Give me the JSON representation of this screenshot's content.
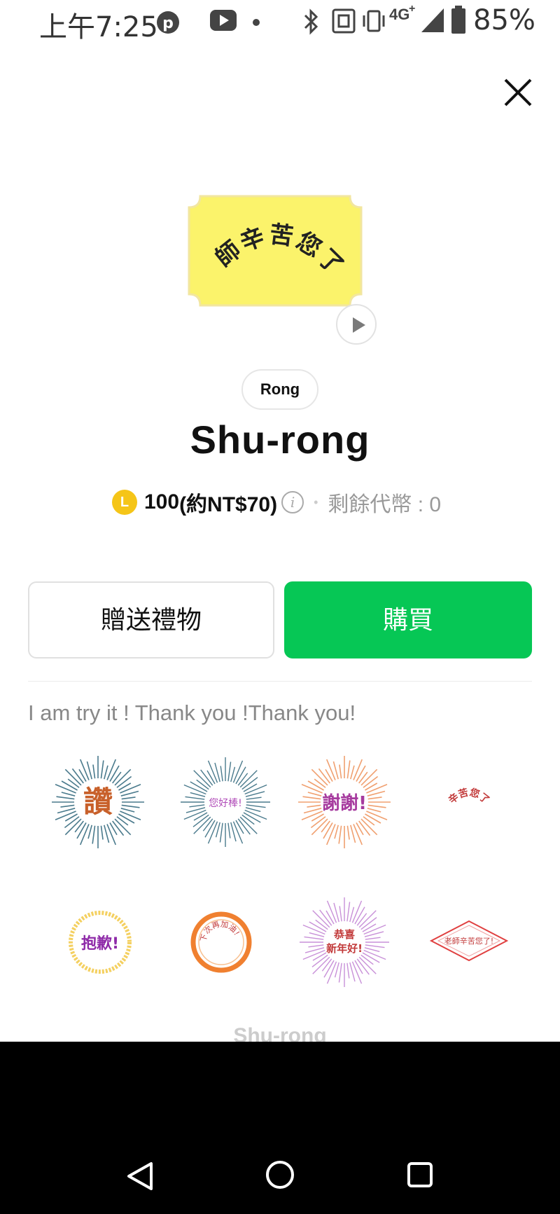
{
  "status_bar": {
    "time": "上午7:25",
    "network": "4G",
    "network_plus": "+",
    "battery": "85%"
  },
  "hero": {
    "sticker_text": "老師辛苦您了!"
  },
  "product": {
    "author": "Rong",
    "title": "Shu-rong",
    "coin_symbol": "L",
    "price": "100",
    "price_local": "(約NT$70)",
    "info_symbol": "i",
    "remaining_coins": "剩餘代幣 : 0"
  },
  "actions": {
    "gift_label": "贈送禮物",
    "buy_label": "購買",
    "buy_color": "#06c755"
  },
  "description": "I am try it ! Thank you !Thank you!",
  "stickers": [
    {
      "text": "讚",
      "color": "#c8602a"
    },
    {
      "text": "您好棒!",
      "color": "#b04bb8"
    },
    {
      "text": "謝謝!",
      "color": "#a63a9e"
    },
    {
      "text": "辛苦您了",
      "color": "#c23a3a"
    },
    {
      "text": "抱歉!",
      "color": "#8e2aa8"
    },
    {
      "text": "下次再加油!",
      "color": "#c23a3a"
    },
    {
      "text_line1": "恭喜",
      "text_line2": "新年好!",
      "color": "#c23a3a"
    },
    {
      "text": "老師辛苦您了!",
      "color": "#c23a3a"
    }
  ],
  "footer_name": "Shu-rong",
  "icons": [
    "pinterest-icon",
    "youtube-icon",
    "bluetooth-icon",
    "nfc-icon",
    "vibrate-icon",
    "signal-icon",
    "battery-icon",
    "close-icon",
    "play-icon",
    "back-icon",
    "home-icon",
    "recents-icon"
  ]
}
